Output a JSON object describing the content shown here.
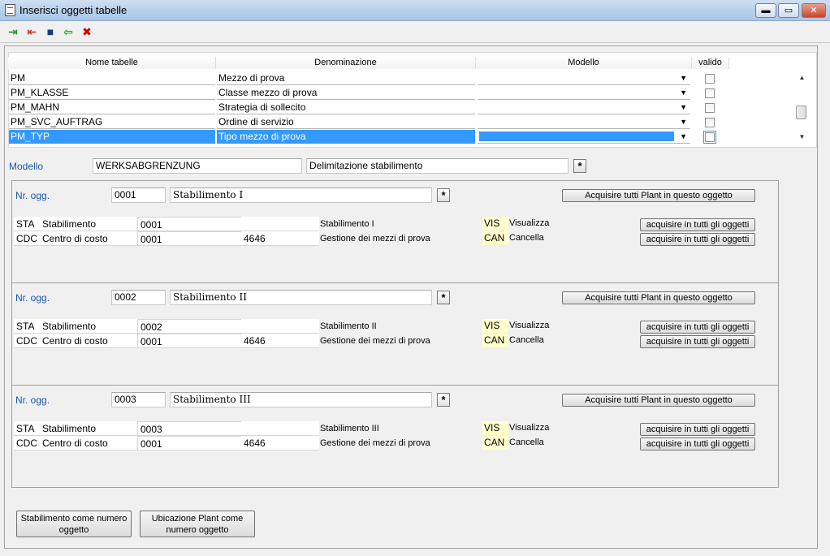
{
  "window": {
    "title": "Inserisci oggetti tabelle",
    "min": "▬",
    "max": "▭",
    "close": "✕"
  },
  "toolbar": {
    "icons": [
      "export-icon",
      "import-icon",
      "save-icon",
      "back-arrow-icon",
      "delete-icon"
    ],
    "glyphs": [
      "⇥",
      "⇤",
      "■",
      "⇦",
      "✖"
    ],
    "colors": [
      "#2e8b2e",
      "#c0392b",
      "#1a3e78",
      "#1e9e1e",
      "#cc0000"
    ]
  },
  "table": {
    "headers": [
      "Nome tabelle",
      "Denominazione",
      "Modello",
      "valido"
    ],
    "rows": [
      {
        "name": "PM",
        "denominazione": "Mezzo di prova"
      },
      {
        "name": "PM_KLASSE",
        "denominazione": "Classe mezzo di prova"
      },
      {
        "name": "PM_MAHN",
        "denominazione": "Strategia di sollecito"
      },
      {
        "name": "PM_SVC_AUFTRAG",
        "denominazione": "Ordine di servizio"
      },
      {
        "name": "PM_TYP",
        "denominazione": "Tipo mezzo di prova"
      }
    ],
    "selected_row": 4,
    "dropdown_glyph": "▼",
    "scroll_up": "▲",
    "scroll_down": "▼"
  },
  "modello": {
    "label": "Modello",
    "value": "WERKSABGRENZUNG",
    "description": "Delimitazione stabilimento",
    "x": "*"
  },
  "objects": [
    {
      "label": "Nr. ogg.",
      "number": "0001",
      "name": "Stabilimento I",
      "x": "*",
      "acquire_label": "Acquisire tutti Plant in questo oggetto",
      "rows": [
        {
          "code": "STA",
          "type": "Stabilimento",
          "value": "0001",
          "extra": "",
          "desc": "Stabilimento I",
          "perm": "VIS",
          "perm_desc": "Visualizza",
          "btn": "acquisire in tutti gli oggetti"
        },
        {
          "code": "CDC",
          "type": "Centro di costo",
          "value": "0001",
          "extra": "4646",
          "desc": "Gestione dei mezzi di prova",
          "perm": "CAN",
          "perm_desc": "Cancella",
          "btn": "acquisire in tutti gli oggetti"
        }
      ]
    },
    {
      "label": "Nr. ogg.",
      "number": "0002",
      "name": "Stabilimento II",
      "x": "*",
      "acquire_label": "Acquisire tutti Plant in questo oggetto",
      "rows": [
        {
          "code": "STA",
          "type": "Stabilimento",
          "value": "0002",
          "extra": "",
          "desc": "Stabilimento II",
          "perm": "VIS",
          "perm_desc": "Visualizza",
          "btn": "acquisire in tutti gli oggetti"
        },
        {
          "code": "CDC",
          "type": "Centro di costo",
          "value": "0001",
          "extra": "4646",
          "desc": "Gestione dei mezzi di prova",
          "perm": "CAN",
          "perm_desc": "Cancella",
          "btn": "acquisire in tutti gli oggetti"
        }
      ]
    },
    {
      "label": "Nr. ogg.",
      "number": "0003",
      "name": "Stabilimento III",
      "x": "*",
      "acquire_label": "Acquisire tutti Plant in questo oggetto",
      "rows": [
        {
          "code": "STA",
          "type": "Stabilimento",
          "value": "0003",
          "extra": "",
          "desc": "Stabilimento III",
          "perm": "VIS",
          "perm_desc": "Visualizza",
          "btn": "acquisire in tutti gli oggetti"
        },
        {
          "code": "CDC",
          "type": "Centro di costo",
          "value": "0001",
          "extra": "4646",
          "desc": "Gestione dei mezzi di prova",
          "perm": "CAN",
          "perm_desc": "Cancella",
          "btn": "acquisire in tutti gli oggetti"
        }
      ]
    }
  ],
  "bottom": {
    "btn1_line1": "Stabilimento come numero",
    "btn1_line2": "oggetto",
    "btn2_line1": "Ubicazione Plant come",
    "btn2_line2": "numero oggetto"
  }
}
